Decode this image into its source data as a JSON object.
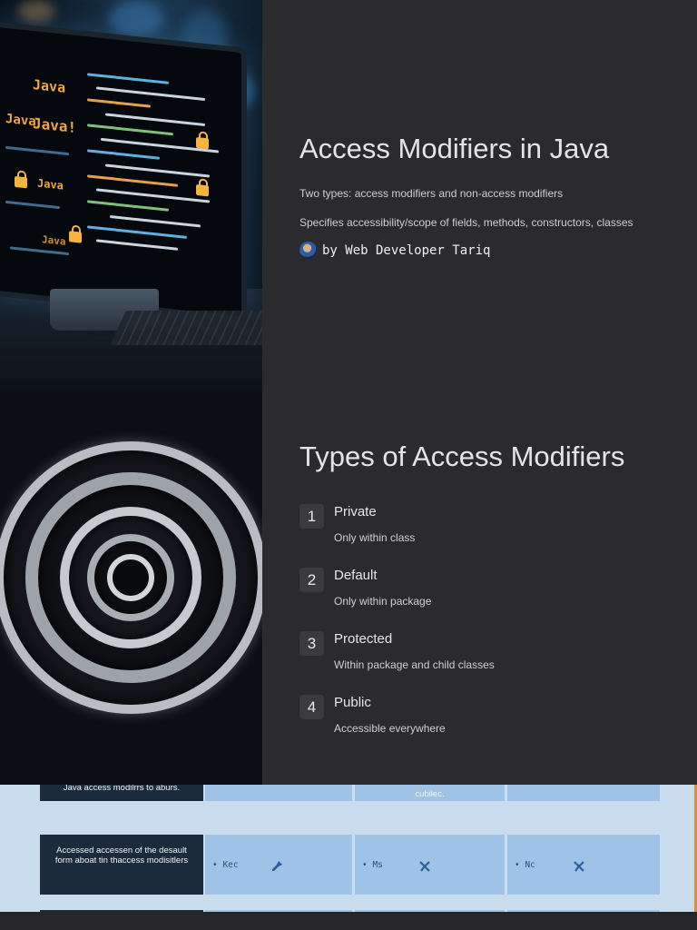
{
  "slide1": {
    "title": "Access Modifiers in Java",
    "paragraphs": [
      "Two types: access modifiers and non-access modifiers",
      "Specifies accessibility/scope of fields, methods, constructors, classes"
    ],
    "author": "by Web Developer Tariq"
  },
  "slide2": {
    "title": "Types of Access Modifiers",
    "items": [
      {
        "num": "1",
        "title": "Private",
        "desc": "Only within class"
      },
      {
        "num": "2",
        "title": "Default",
        "desc": "Only within package"
      },
      {
        "num": "3",
        "title": "Protected",
        "desc": "Within package and child classes"
      },
      {
        "num": "4",
        "title": "Public",
        "desc": "Accessible everywhere"
      }
    ]
  },
  "slide3": {
    "row1_dark": "Java access modilrrs to aburs.",
    "row1_cell2": "cubilec.",
    "row2_dark": "Accessed accessen of the desault form aboat tin thaccess modisitlers",
    "row2_cells": [
      "• Kec",
      "• Ms",
      "• Nc"
    ]
  },
  "colors": {
    "background": "#2b2b2d",
    "number_badge": "#3b3b3e",
    "table_cell": "#9fc3e6",
    "table_header": "#1c2b3c",
    "code_accent": "#f2a63a"
  }
}
